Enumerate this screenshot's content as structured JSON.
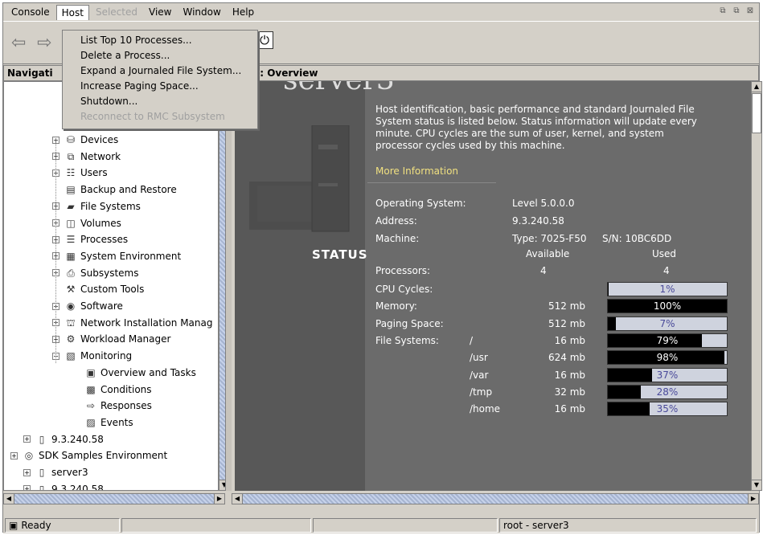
{
  "menu": {
    "items": [
      "Console",
      "Host",
      "Selected",
      "View",
      "Window",
      "Help"
    ]
  },
  "host_menu": {
    "items": [
      {
        "label": "List Top 10 Processes...",
        "enabled": true
      },
      {
        "label": "Delete a Process...",
        "enabled": true
      },
      {
        "label": "Expand a Journaled File System...",
        "enabled": true
      },
      {
        "label": "Increase Paging Space...",
        "enabled": true
      },
      {
        "label": "Shutdown...",
        "enabled": true
      },
      {
        "label": "Reconnect to RMC Subsystem",
        "enabled": false
      }
    ]
  },
  "nav": {
    "header": "Navigati",
    "tree": [
      {
        "label": "Devices",
        "icon": "devices-icon",
        "glyph": "⛁",
        "expander": "+"
      },
      {
        "label": "Network",
        "icon": "network-icon",
        "glyph": "⧉",
        "expander": "+"
      },
      {
        "label": "Users",
        "icon": "users-icon",
        "glyph": "☷",
        "expander": "+"
      },
      {
        "label": "Backup and Restore",
        "icon": "backup-icon",
        "glyph": "▤",
        "expander": ""
      },
      {
        "label": "File Systems",
        "icon": "file-systems-icon",
        "glyph": "▰",
        "expander": "+"
      },
      {
        "label": "Volumes",
        "icon": "volumes-icon",
        "glyph": "◫",
        "expander": "+"
      },
      {
        "label": "Processes",
        "icon": "processes-icon",
        "glyph": "☰",
        "expander": "+"
      },
      {
        "label": "System Environment",
        "icon": "system-environment-icon",
        "glyph": "▦",
        "expander": "+"
      },
      {
        "label": "Subsystems",
        "icon": "subsystems-icon",
        "glyph": "⎙",
        "expander": "+"
      },
      {
        "label": "Custom Tools",
        "icon": "custom-tools-icon",
        "glyph": "⚒",
        "expander": ""
      },
      {
        "label": "Software",
        "icon": "software-icon",
        "glyph": "◉",
        "expander": "+"
      },
      {
        "label": "Network Installation Manag",
        "icon": "nim-icon",
        "glyph": "⛫",
        "expander": "+"
      },
      {
        "label": "Workload Manager",
        "icon": "workload-manager-icon",
        "glyph": "⚙",
        "expander": "+"
      },
      {
        "label": "Monitoring",
        "icon": "monitoring-icon",
        "glyph": "▧",
        "expander": "−"
      }
    ],
    "monitoring_children": [
      {
        "label": "Overview and Tasks",
        "icon": "overview-icon",
        "glyph": "▣"
      },
      {
        "label": "Conditions",
        "icon": "conditions-icon",
        "glyph": "▩"
      },
      {
        "label": "Responses",
        "icon": "responses-icon",
        "glyph": "⇨"
      },
      {
        "label": "Events",
        "icon": "events-icon",
        "glyph": "▨"
      }
    ],
    "hosts": [
      {
        "label": "9.3.240.58",
        "level": 1,
        "icon": "host-icon",
        "glyph": "▯"
      },
      {
        "label": "SDK Samples Environment",
        "level": 0,
        "icon": "environment-icon",
        "glyph": "◎"
      },
      {
        "label": "server3",
        "level": 1,
        "icon": "host-icon",
        "glyph": "▯"
      },
      {
        "label": "9.3.240.58",
        "level": 1,
        "icon": "host-icon",
        "glyph": "▯"
      }
    ]
  },
  "overview": {
    "header": "ver3: Overview",
    "server_title": "server3",
    "status_label": "STATUS",
    "description": "Host identification, basic performance and standard Journaled File System status is listed below. Status information will update every minute. CPU cycles are the sum of user, kernel, and system processor cycles used by this machine.",
    "more_info": "More Information",
    "os_label": "Operating System:",
    "os_value": "Level 5.0.0.0",
    "address_label": "Address:",
    "address_value": "9.3.240.58",
    "machine_label": "Machine:",
    "machine_type": "Type: 7025-F50",
    "machine_sn": "S/N: 10BC6DD",
    "available_header": "Available",
    "used_header": "Used",
    "processors_label": "Processors:",
    "processors_available": "4",
    "processors_used": "4",
    "cpu_label": "CPU Cycles:",
    "memory_label": "Memory:",
    "paging_label": "Paging Space:",
    "fs_label": "File Systems:",
    "metrics": [
      {
        "label": "CPU Cycles:",
        "mount": "",
        "available": "",
        "percent": "1%",
        "fill": 0.01
      },
      {
        "label": "Memory:",
        "mount": "",
        "available": "512 mb",
        "percent": "100%",
        "fill": 1.0
      },
      {
        "label": "Paging Space:",
        "mount": "",
        "available": "512 mb",
        "percent": "7%",
        "fill": 0.07
      },
      {
        "label": "File Systems:",
        "mount": "/",
        "available": "16 mb",
        "percent": "79%",
        "fill": 0.79
      },
      {
        "label": "",
        "mount": "/usr",
        "available": "624 mb",
        "percent": "98%",
        "fill": 0.98
      },
      {
        "label": "",
        "mount": "/var",
        "available": "16 mb",
        "percent": "37%",
        "fill": 0.37
      },
      {
        "label": "",
        "mount": "/tmp",
        "available": "32 mb",
        "percent": "28%",
        "fill": 0.28
      },
      {
        "label": "",
        "mount": "/home",
        "available": "16 mb",
        "percent": "35%",
        "fill": 0.35
      }
    ]
  },
  "statusbar": {
    "ready": "Ready",
    "user": "root - server3"
  }
}
